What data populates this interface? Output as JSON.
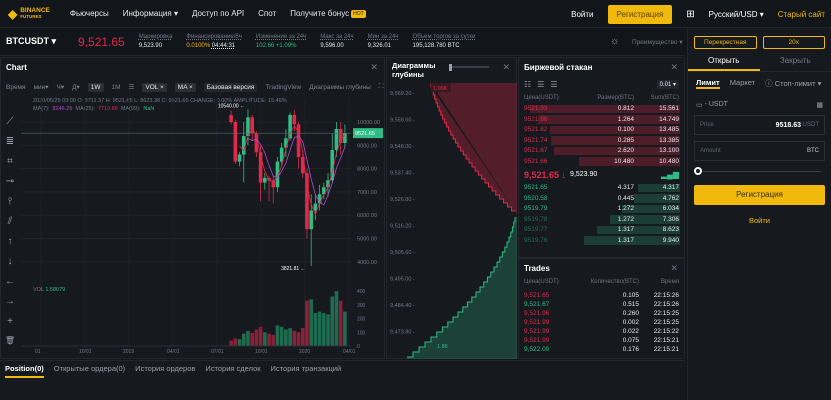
{
  "nav": {
    "logo_top": "BINANCE",
    "logo_bottom": "FUTURES",
    "items": [
      "Фьючерсы",
      "Информация ▾",
      "Доступ по API",
      "Спот",
      "Получите бонус"
    ],
    "hot": "HOT",
    "login": "Войти",
    "register": "Регистрация",
    "lang": "Русский/USD ▾",
    "old_site": "Старый сайт"
  },
  "ticker": {
    "symbol": "BTCUSDT ▾",
    "price": "9,521.65",
    "stats": [
      {
        "label": "Маркировка",
        "value": "9,523.90",
        "color": "#e6e8ea"
      },
      {
        "label": "Финансирование/8ч",
        "value": "0.0100%",
        "value2": "04:44:31",
        "color": "#f0b90b"
      },
      {
        "label": "Изменение за 24ч",
        "value": "102.66 +1.09%",
        "color": "#2ebd85"
      },
      {
        "label": "Макс за 24ч",
        "value": "9,596.00",
        "color": "#e6e8ea"
      },
      {
        "label": "Мин за 24ч",
        "value": "9,326.01",
        "color": "#e6e8ea"
      },
      {
        "label": "Объем торгов за сутки",
        "value": "195,128.780 BTC",
        "color": "#e6e8ea"
      }
    ],
    "advantage": "Преимущество ▾"
  },
  "chart": {
    "title": "Chart",
    "toolbar": [
      "Время",
      "мин▾",
      "Ч▾",
      "Д▾",
      "1W",
      "1M"
    ],
    "vol_chip": "VOL ×",
    "ma_chip": "MA ×",
    "basic": "Базовая версия",
    "tradingview": "TradingView",
    "depth": "Диаграммы глубины",
    "info": "2020/05/25 03:00 O: 8711.37 H: 9521.65 L: 8623.38 C: 9521.65 CHANGE: 0.00% AMPLITUDE: 15.46%",
    "ma7_label": "MA(7):",
    "ma7": "8246.25",
    "ma25_label": "MA(25):",
    "ma25": "7710.86",
    "ma99_label": "MA(99):",
    "ma99": "NaN",
    "vol_label": "VOL",
    "vol": "1.58079",
    "high_marker": "10540.00 ←",
    "low_marker": "3821.81 ←",
    "price_tag": "9521.65"
  },
  "chart_data": {
    "type": "candlestick",
    "y_ticks": [
      "10000.00",
      "9000.00",
      "8000.00",
      "7000.00",
      "6000.00",
      "5000.00",
      "4000.00"
    ],
    "ylim": [
      3500,
      10700
    ],
    "x_ticks": [
      "01",
      "10/01",
      "2019",
      "04/01",
      "07/01",
      "10/01",
      "2020",
      "04/01"
    ],
    "vol_ticks": [
      "400",
      "300",
      "200",
      "100",
      "0"
    ],
    "candles": [
      [
        10300,
        10500,
        9900,
        10000
      ],
      [
        10000,
        10100,
        8200,
        8300
      ],
      [
        8300,
        8700,
        8100,
        8600
      ],
      [
        8600,
        10000,
        7400,
        9400
      ],
      [
        9400,
        10540,
        9000,
        10200
      ],
      [
        10200,
        10300,
        9200,
        9500
      ],
      [
        9500,
        9600,
        8500,
        8700
      ],
      [
        8700,
        9000,
        6600,
        7400
      ],
      [
        7400,
        7800,
        7100,
        7600
      ],
      [
        7600,
        7700,
        6600,
        7500
      ],
      [
        7500,
        7700,
        6500,
        7200
      ],
      [
        7200,
        8500,
        7000,
        8300
      ],
      [
        8300,
        9100,
        8100,
        8900
      ],
      [
        8900,
        9700,
        8500,
        9300
      ],
      [
        9300,
        10400,
        9200,
        10300
      ],
      [
        10300,
        10500,
        9600,
        9900
      ],
      [
        9900,
        10000,
        8000,
        8500
      ],
      [
        8500,
        8800,
        7600,
        7800
      ],
      [
        7800,
        8000,
        5000,
        5400
      ],
      [
        5400,
        6900,
        3821,
        6200
      ],
      [
        6200,
        6900,
        5800,
        6500
      ],
      [
        6500,
        7300,
        6200,
        6900
      ],
      [
        6900,
        7400,
        6700,
        7200
      ],
      [
        7200,
        7800,
        6800,
        7500
      ],
      [
        7500,
        9500,
        7400,
        8800
      ],
      [
        8800,
        10000,
        8500,
        9700
      ],
      [
        9700,
        10000,
        8600,
        9100
      ],
      [
        9100,
        9900,
        8900,
        9521.65
      ]
    ],
    "volumes": [
      40,
      55,
      50,
      90,
      110,
      95,
      120,
      140,
      100,
      90,
      80,
      150,
      140,
      120,
      130,
      110,
      100,
      130,
      330,
      340,
      240,
      250,
      240,
      230,
      360,
      400,
      330,
      250
    ]
  },
  "depth": {
    "title": "Диаграммы глубины",
    "y_labels": [
      "9,569.20",
      "9,558.60",
      "9,548.00",
      "9,537.40",
      "9,526.80",
      "9,516.20",
      "9,505.60",
      "9,495.00",
      "9,484.40",
      "9,473.80"
    ],
    "ask_label": "1.06K",
    "bid_label": "1.86"
  },
  "orderbook": {
    "title": "Биржевой стакан",
    "precision": "0.01 ▾",
    "headers": [
      "Цена(USDT)",
      "Размер(BTC)",
      "Sum(BTC)"
    ],
    "asks": [
      [
        "9521.93",
        "0.812",
        "15.561"
      ],
      [
        "9521.86",
        "1.264",
        "14.749"
      ],
      [
        "9521.82",
        "0.100",
        "13.485"
      ],
      [
        "9521.74",
        "0.285",
        "13.385"
      ],
      [
        "9521.67",
        "2.620",
        "13.100"
      ],
      [
        "9521.66",
        "10.480",
        "10.480"
      ]
    ],
    "last": "9,521.65 ↓",
    "mark": "9,523.90",
    "bids": [
      [
        "9521.65",
        "4.317",
        "4.317"
      ],
      [
        "9520.58",
        "0.445",
        "4.762"
      ],
      [
        "9519.79",
        "1.272",
        "6.034"
      ],
      [
        "9519.78",
        "1.272",
        "7.306"
      ],
      [
        "9519.77",
        "1.317",
        "8.623"
      ],
      [
        "9519.76",
        "1.317",
        "9.940"
      ]
    ]
  },
  "trades": {
    "title": "Trades",
    "headers": [
      "Цена(USDT)",
      "Количество(BTC)",
      "Время"
    ],
    "rows": [
      [
        "9,521.65",
        "0.105",
        "22:15:26",
        "sell"
      ],
      [
        "9,521.67",
        "0.515",
        "22:15:26",
        "buy"
      ],
      [
        "9,521.96",
        "0.260",
        "22:15:25",
        "sell"
      ],
      [
        "9,521.99",
        "0.002",
        "22:15:25",
        "sell"
      ],
      [
        "9,521.99",
        "0.022",
        "22:15:22",
        "sell"
      ],
      [
        "9,521.99",
        "0.075",
        "22:15:21",
        "sell"
      ],
      [
        "9,522.00",
        "0.176",
        "22:15:21",
        "buy"
      ]
    ]
  },
  "order": {
    "margin": "Перекрестная",
    "leverage": "20x",
    "open": "Открыть",
    "close": "Закрыть",
    "types": [
      "Лимит",
      "Маркет",
      "ⓘ Стоп-лимит ▾"
    ],
    "balance": "- USDT",
    "price_ph": "Price",
    "price": "9518.63",
    "price_unit": "USDT",
    "amount_ph": "Amount",
    "amount_unit": "BTC",
    "slider_percent": 0,
    "register": "Регистрация",
    "login": "Войти"
  },
  "bottom_tabs": [
    "Position(0)",
    "Открытые ордера(0)",
    "История ордеров",
    "История сделок",
    "История транзакций"
  ]
}
